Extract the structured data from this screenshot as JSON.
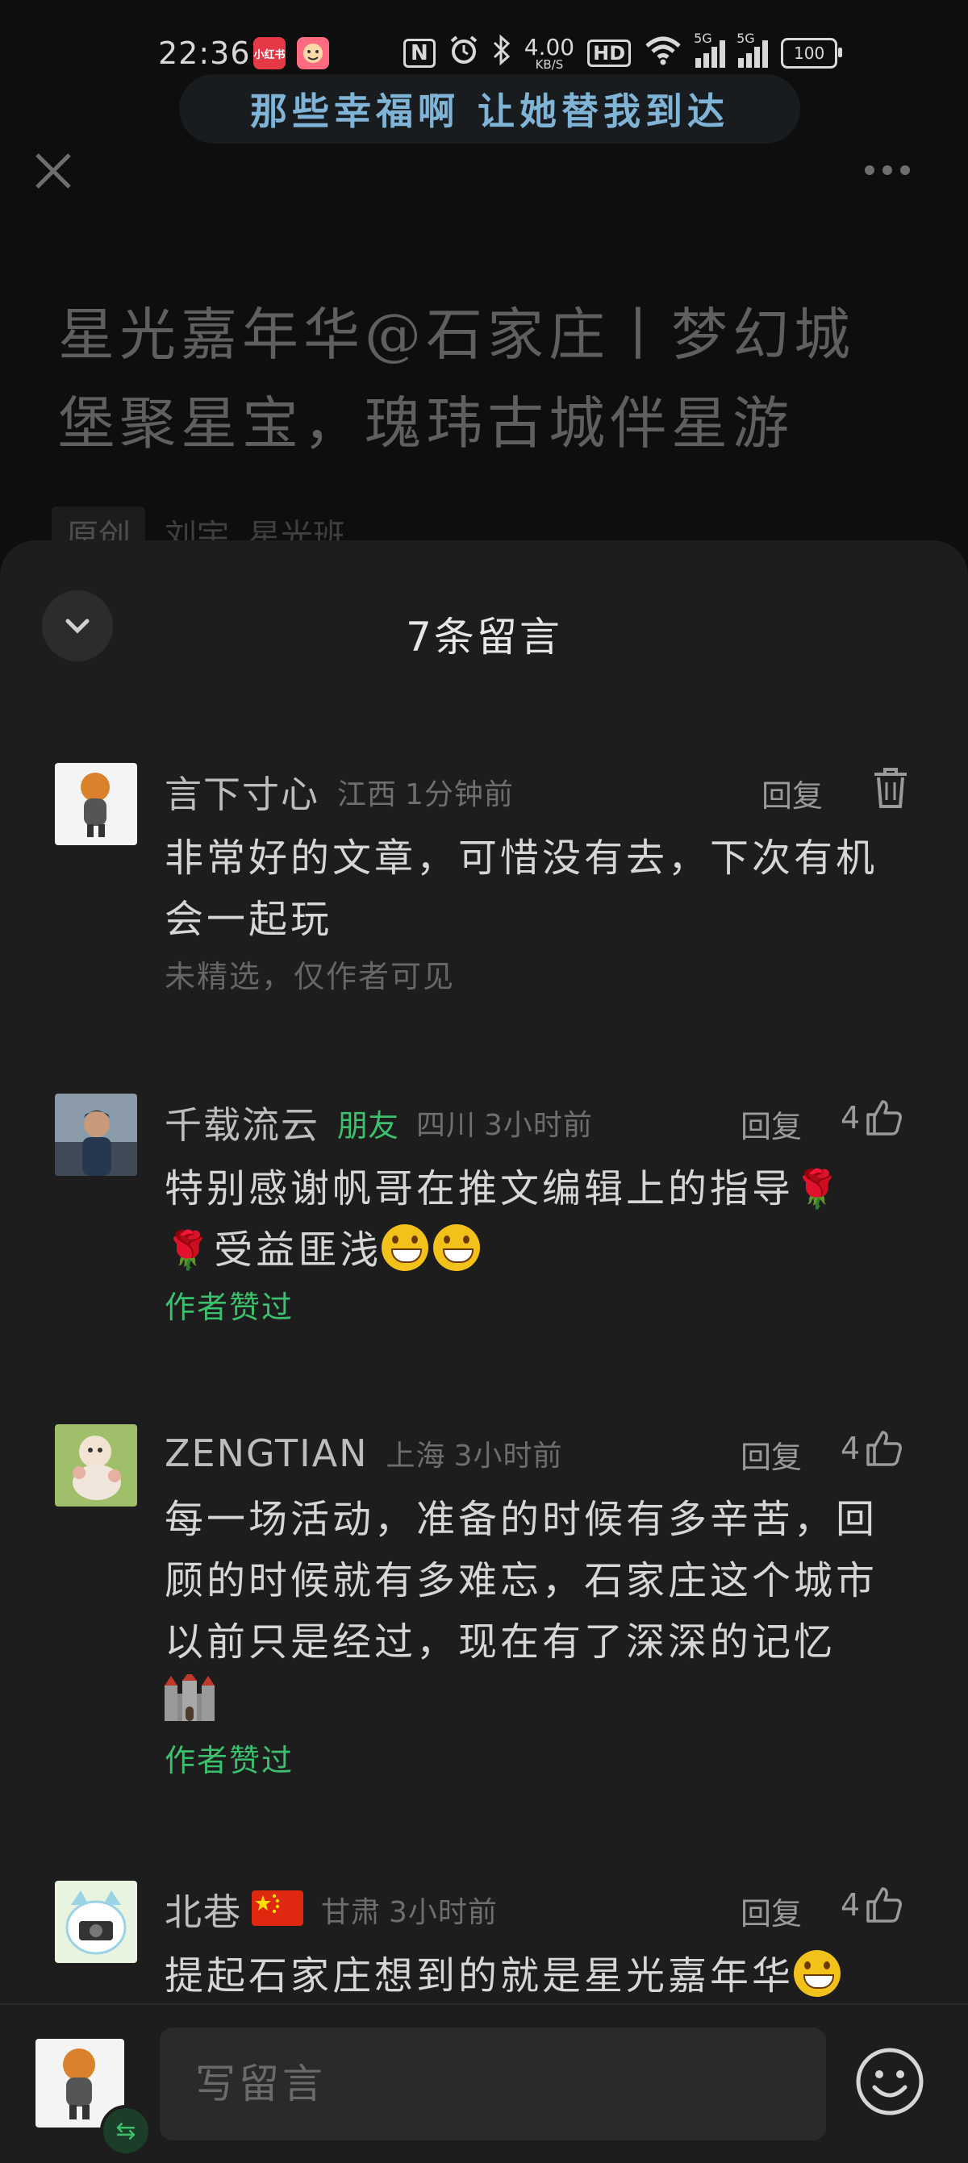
{
  "status_bar": {
    "time": "22:36",
    "app_badge_1": "小红书",
    "net_speed": "4.00",
    "net_unit": "KB/S",
    "hd": "HD",
    "signal_1": "5G",
    "signal_2": "5G",
    "battery": "100"
  },
  "music": {
    "lyric": "那些幸福啊 让她替我到达"
  },
  "article": {
    "title": "星光嘉年华@石家庄丨梦幻城堡聚星宝，瑰玮古城伴星游",
    "tag_original": "原创",
    "tag_author": "刘宇",
    "tag_account": "星光班"
  },
  "sheet": {
    "title": "7条留言"
  },
  "comments": [
    {
      "name": "言下寸心",
      "location": "江西",
      "time": "1分钟前",
      "reply": "回复",
      "body": "非常好的文章，可惜没有去，下次有机会一起玩",
      "note": "未精选，仅作者可见"
    },
    {
      "name": "千载流云",
      "friend": "朋友",
      "location": "四川",
      "time": "3小时前",
      "reply": "回复",
      "likes": "4",
      "body_1": "特别感谢帆哥在推文编辑上的指导",
      "body_2": "受益匪浅",
      "liked": "作者赞过"
    },
    {
      "name": "ZENGTIAN",
      "location": "上海",
      "time": "3小时前",
      "reply": "回复",
      "likes": "4",
      "body": "每一场活动，准备的时候有多辛苦，回顾的时候就有多难忘，石家庄这个城市以前只是经过，现在有了深深的记忆",
      "liked": "作者赞过"
    },
    {
      "name": "北巷",
      "location": "甘肃",
      "time": "3小时前",
      "reply": "回复",
      "likes": "4",
      "body": "提起石家庄想到的就是星光嘉年华"
    }
  ],
  "input_bar": {
    "placeholder": "写留言"
  },
  "colors": {
    "accent_green": "#3cc06e",
    "sheet_bg": "#1d1d1d",
    "lyric": "#7fb4d6"
  },
  "icons": [
    "close-icon",
    "more-icon",
    "chevron-down-icon",
    "trash-icon",
    "thumbs-up-icon",
    "emoji-icon",
    "switch-account-icon",
    "rose-emoji",
    "grin-emoji",
    "castle-emoji",
    "china-flag-emoji"
  ]
}
